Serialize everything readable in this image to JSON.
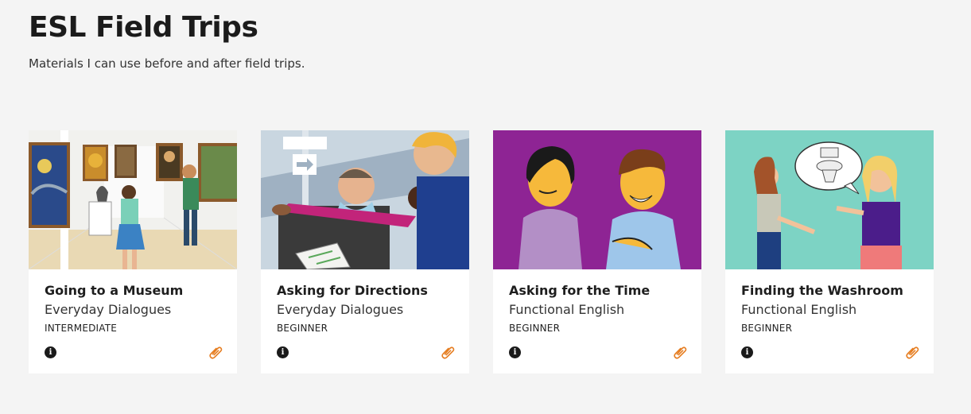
{
  "header": {
    "title": "ESL Field Trips",
    "subtitle": "Materials I can use before and after field trips."
  },
  "cards": [
    {
      "title": "Going to a Museum",
      "category": "Everyday Dialogues",
      "level": "INTERMEDIATE",
      "image": "museum-gallery-illustration",
      "icons": [
        "info-icon",
        "paperclip-icon"
      ]
    },
    {
      "title": "Asking for Directions",
      "category": "Everyday Dialogues",
      "level": "BEGINNER",
      "image": "people-pointing-directions-illustration",
      "icons": [
        "info-icon",
        "paperclip-icon"
      ]
    },
    {
      "title": "Asking for the Time",
      "category": "Functional English",
      "level": "BEGINNER",
      "image": "two-people-talking-purple-illustration",
      "icons": [
        "info-icon",
        "paperclip-icon"
      ]
    },
    {
      "title": "Finding the Washroom",
      "category": "Functional English",
      "level": "BEGINNER",
      "image": "washroom-speech-bubble-illustration",
      "icons": [
        "info-icon",
        "paperclip-icon"
      ]
    }
  ],
  "colors": {
    "background": "#f4f4f4",
    "card": "#ffffff",
    "attachment_accent": "#e67e22"
  }
}
